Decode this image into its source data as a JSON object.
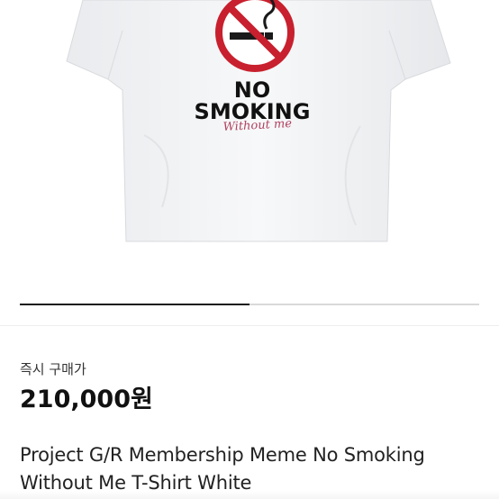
{
  "product": {
    "image": {
      "sign_text_line1": "NO",
      "sign_text_line2": "SMOKING",
      "handwritten_text": "Without me",
      "sign_color": "#c8202e"
    },
    "carousel_progress": 0.5,
    "purchase_type": "즉시 구매가",
    "price": "210,000원",
    "title": "Project G/R Membership Meme No Smoking Without Me T-Shirt White"
  },
  "colors": {
    "price_text": "#111111",
    "accent_red": "#c8202e",
    "shirt": "#f4f5f6",
    "handwriting": "#b0405e"
  }
}
